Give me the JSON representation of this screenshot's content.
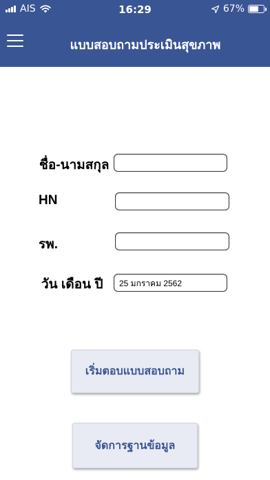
{
  "status_bar": {
    "carrier": "AIS",
    "time": "16:29",
    "battery": "67%",
    "icons": [
      "signal-icon",
      "wifi-icon",
      "location-arrow-icon",
      "battery-icon"
    ]
  },
  "header": {
    "title": "แบบสอบถามประเมินสุขภาพ",
    "menu_icon": "hamburger-menu-icon",
    "background_color": "#3a5594"
  },
  "form": {
    "name_label": "ชื่อ-นามสกุล",
    "name_value": "",
    "hn_label": "HN",
    "hn_value": "",
    "hospital_label": "รพ.",
    "hospital_value": "",
    "date_label": "วัน เดือน ปี",
    "date_value": "25 มกราคม 2562"
  },
  "buttons": {
    "start_survey": "เริ่มตอบแบบสอบถาม",
    "manage_data": "จัดการฐานข้อมูล"
  }
}
